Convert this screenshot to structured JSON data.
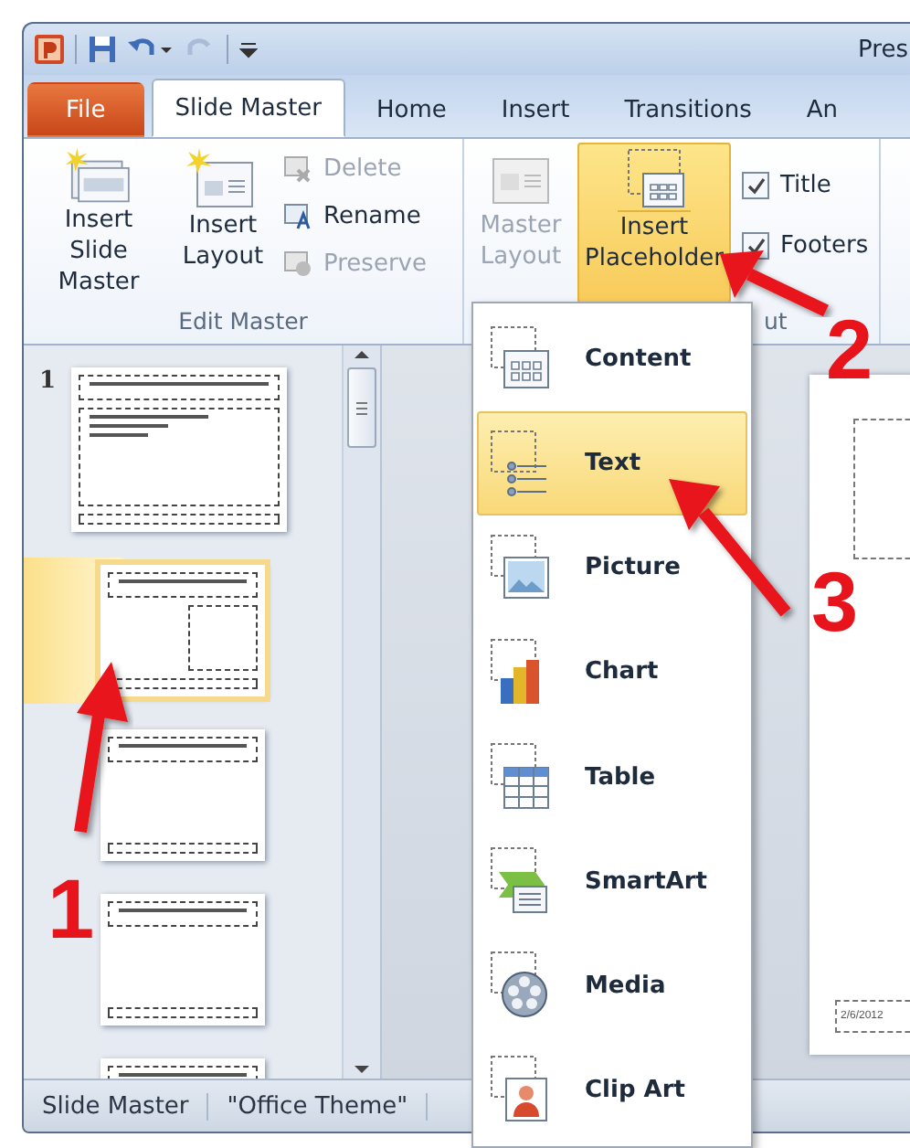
{
  "window": {
    "title": "Pres"
  },
  "tabs": [
    {
      "label": "File",
      "kind": "file",
      "selected": false
    },
    {
      "label": "Slide Master",
      "kind": "tab",
      "selected": true
    },
    {
      "label": "Home",
      "kind": "tab",
      "selected": false
    },
    {
      "label": "Insert",
      "kind": "tab",
      "selected": false
    },
    {
      "label": "Transitions",
      "kind": "tab",
      "selected": false
    },
    {
      "label": "An",
      "kind": "tab",
      "selected": false
    }
  ],
  "ribbon": {
    "groups": [
      {
        "label": "Edit Master",
        "large_buttons": [
          {
            "label": "Insert Slide Master",
            "disabled": false,
            "pressed": false
          },
          {
            "label": "Insert Layout",
            "disabled": false,
            "pressed": false
          }
        ],
        "small_buttons": [
          {
            "label": "Delete",
            "disabled": true
          },
          {
            "label": "Rename",
            "disabled": false
          },
          {
            "label": "Preserve",
            "disabled": true
          }
        ]
      },
      {
        "label": "ut",
        "large_buttons": [
          {
            "label": "Master Layout",
            "disabled": true,
            "pressed": false
          },
          {
            "label": "Insert Placeholder",
            "disabled": false,
            "pressed": true
          }
        ],
        "checkboxes": [
          {
            "label": "Title",
            "checked": true
          },
          {
            "label": "Footers",
            "checked": true
          }
        ]
      }
    ]
  },
  "slide_panel": {
    "thumbnails": [
      {
        "number": "1",
        "kind": "master",
        "selected": false
      },
      {
        "kind": "layout-side",
        "selected": true
      },
      {
        "kind": "layout",
        "selected": false
      },
      {
        "kind": "layout",
        "selected": false
      },
      {
        "kind": "layout",
        "selected": false
      }
    ]
  },
  "placeholder_menu": {
    "items": [
      {
        "label": "Content",
        "selected": false
      },
      {
        "label": "Text",
        "selected": true
      },
      {
        "label": "Picture",
        "selected": false
      },
      {
        "label": "Chart",
        "selected": false
      },
      {
        "label": "Table",
        "selected": false
      },
      {
        "label": "SmartArt",
        "selected": false
      },
      {
        "label": "Media",
        "selected": false
      },
      {
        "label": "Clip Art",
        "selected": false
      }
    ]
  },
  "slide_canvas": {
    "date_placeholder": "2/6/2012"
  },
  "status_bar": {
    "items": [
      "Slide Master",
      "\"Office Theme\""
    ]
  },
  "annotations": [
    {
      "label": "1"
    },
    {
      "label": "2"
    },
    {
      "label": "3"
    }
  ]
}
